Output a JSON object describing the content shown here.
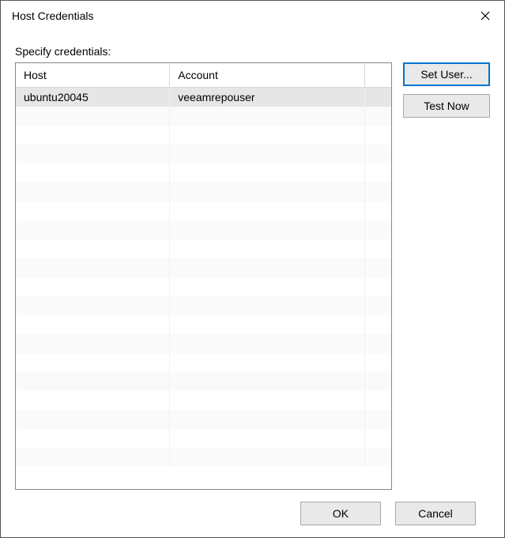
{
  "window": {
    "title": "Host Credentials"
  },
  "label": "Specify credentials:",
  "table": {
    "columns": {
      "host": "Host",
      "account": "Account"
    },
    "rows": [
      {
        "host": "ubuntu20045",
        "account": "veeamrepouser"
      }
    ]
  },
  "buttons": {
    "set_user": "Set User...",
    "test_now": "Test Now",
    "ok": "OK",
    "cancel": "Cancel"
  }
}
